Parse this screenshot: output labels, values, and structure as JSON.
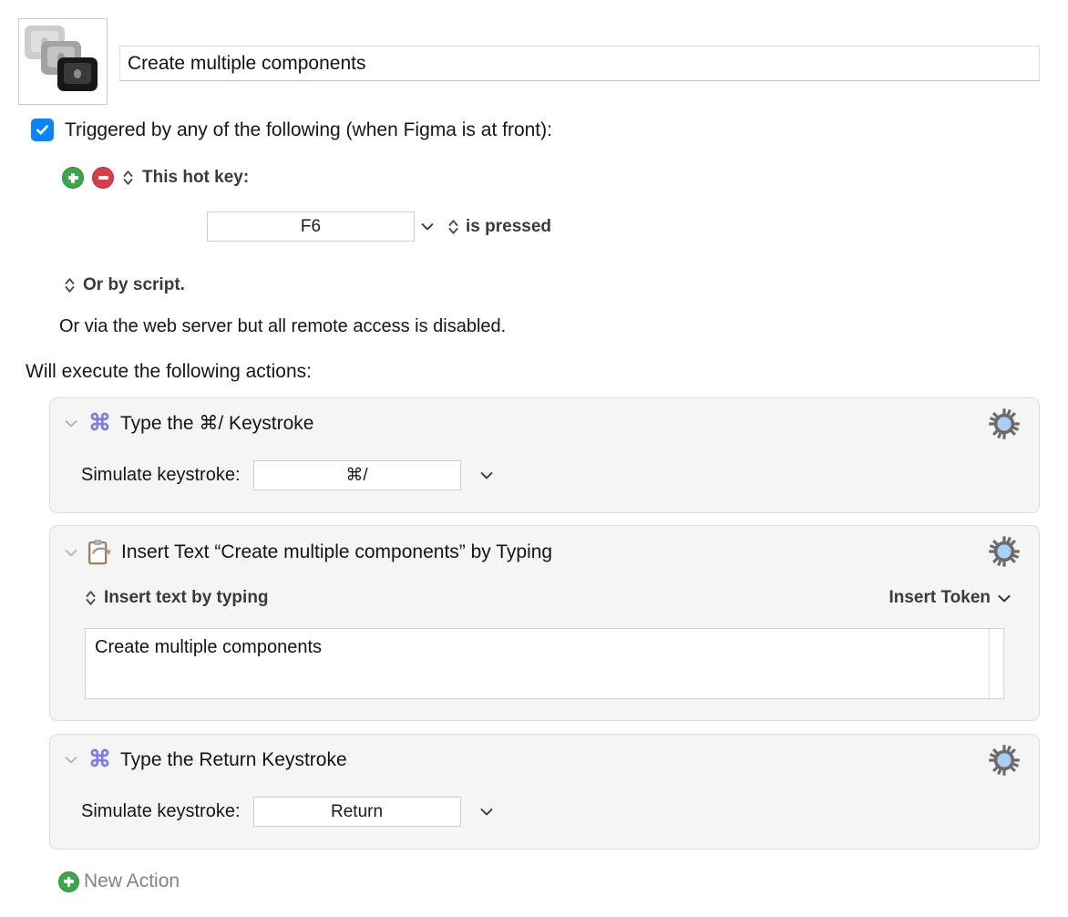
{
  "macro": {
    "icon_name": "stacked-keycaps-icon",
    "title_value": "Create multiple components",
    "title_placeholder": "Macro Name"
  },
  "trigger": {
    "checkbox_checked": true,
    "label": "Triggered by any of the following (when Figma is at front):",
    "add_button_label": "+",
    "remove_button_label": "−",
    "hotkey_label": "This hot key:",
    "hotkey_value": "F6",
    "hotkey_condition": "is pressed",
    "script_label": "Or by script.",
    "webserver_note": "Or via the web server but all remote access is disabled."
  },
  "actions_header": "Will execute the following actions:",
  "actions": [
    {
      "icon": "command-icon",
      "title": "Type the ⌘/ Keystroke",
      "field_label": "Simulate keystroke:",
      "field_value": "⌘/",
      "gear_icon": "gear-icon"
    },
    {
      "icon": "clipboard-icon",
      "title": "Insert Text “Create multiple components” by Typing",
      "mode_label": "Insert text by typing",
      "token_label": "Insert Token",
      "text_value": "Create multiple components",
      "gear_icon": "gear-icon"
    },
    {
      "icon": "command-icon",
      "title": "Type the Return Keystroke",
      "field_label": "Simulate keystroke:",
      "field_value": "Return",
      "gear_icon": "gear-icon"
    }
  ],
  "footer": {
    "new_action_label": "New Action"
  },
  "colors": {
    "accent_checkbox": "#0A84FF",
    "command_purple": "#7B7BEF",
    "add_green": "#3AA845",
    "remove_red": "#DE3B4B",
    "gear_gray": "#6B6B6B",
    "gear_center_blue": "#A9CFF5",
    "card_bg": "#F5F5F5"
  }
}
